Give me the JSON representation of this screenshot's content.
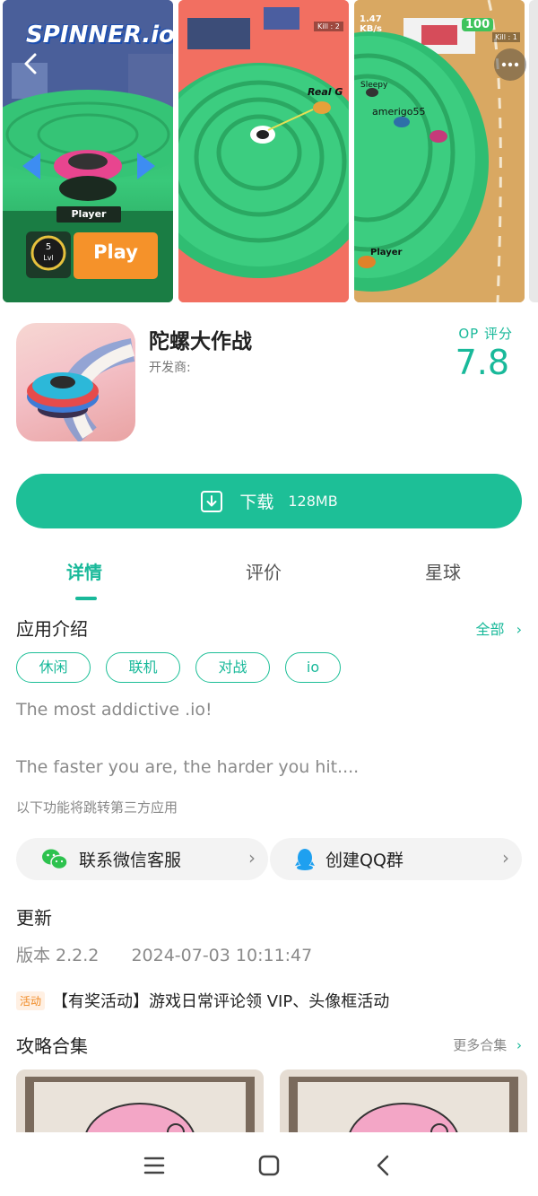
{
  "screenshots": {
    "shot1": {
      "game_title": "SPINNER.io",
      "player_label": "Player",
      "level_number": "5",
      "level_unit": "Lvl",
      "play_label": "Play"
    },
    "shot2": {
      "kill_counter": "Kill : 2",
      "player_name": "Real G"
    },
    "shot3": {
      "speed_value": "1.47",
      "speed_unit": "KB/s",
      "battery": "100",
      "kill_counter": "Kill : 1",
      "player_name_1": "Sleepy",
      "player_name_2": "amerigo55",
      "player_name_3": "Player"
    }
  },
  "app": {
    "title": "陀螺大作战",
    "developer_label": "开发商:",
    "score_label": "OP 评分",
    "score_value": "7.8"
  },
  "download": {
    "label": "下载",
    "size": "128MB"
  },
  "tabs": [
    {
      "label": "详情",
      "active": true
    },
    {
      "label": "评价",
      "active": false
    },
    {
      "label": "星球",
      "active": false
    }
  ],
  "intro": {
    "title": "应用介绍",
    "all_label": "全部",
    "tags": [
      "休闲",
      "联机",
      "对战",
      "io"
    ],
    "desc_line1": "The most addictive .io!",
    "desc_line2": "The faster you are, the harder you hit....",
    "note": "以下功能将跳转第三方应用"
  },
  "services": {
    "wechat": {
      "label": "联系微信客服",
      "icon": "wechat-icon",
      "color": "#2dc24e"
    },
    "qq": {
      "label": "创建QQ群",
      "icon": "qq-icon",
      "color": "#1ea0f0"
    }
  },
  "update": {
    "title": "更新",
    "version": "版本 2.2.2",
    "date": "2024-07-03 10:11:47"
  },
  "activity": {
    "badge": "活动",
    "text": "【有奖活动】游戏日常评论领 VIP、头像框活动"
  },
  "guides": {
    "title": "攻略合集",
    "more_label": "更多合集"
  },
  "colors": {
    "accent": "#1dbf97"
  }
}
